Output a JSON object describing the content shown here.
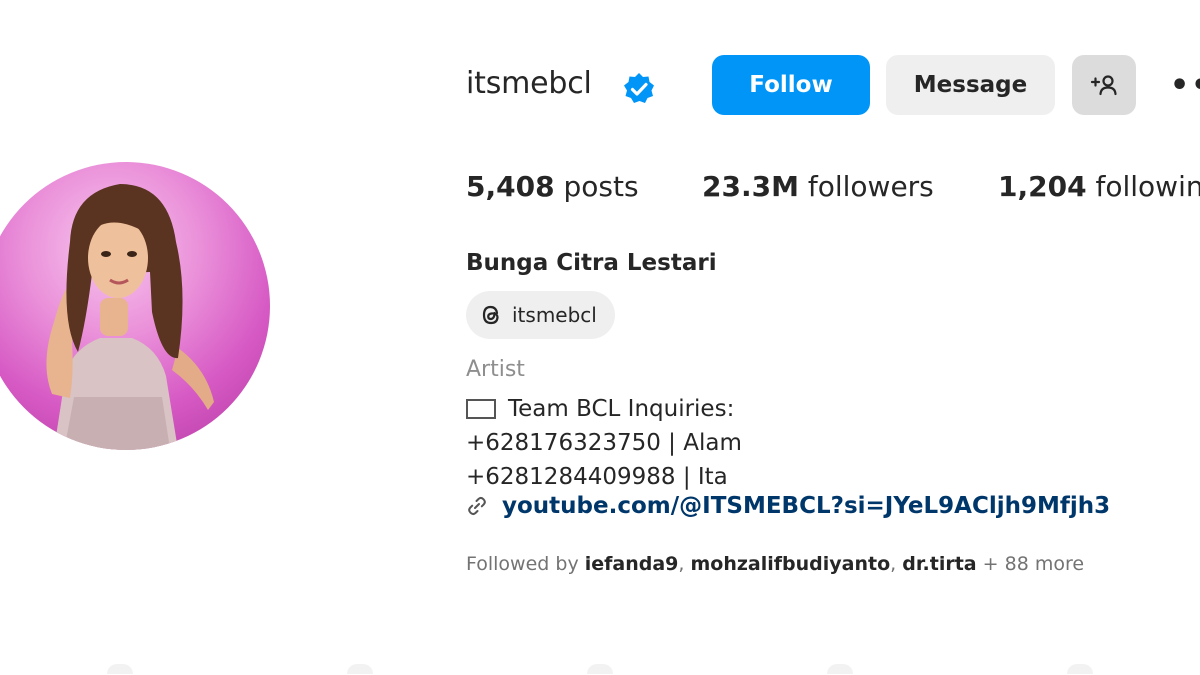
{
  "profile": {
    "username": "itsmebcl",
    "full_name": "Bunga Citra Lestari",
    "threads_handle": "itsmebcl",
    "category": "Artist",
    "bio_lines": [
      "Team BCL Inquiries:",
      "+628176323750 | Alam",
      "+6281284409988 | Ita"
    ],
    "link": "youtube.com/@ITSMEBCL?si=JYeL9ACljh9Mfjh3"
  },
  "stats": {
    "posts_count": "5,408",
    "posts_label": "posts",
    "followers_count": "23.3M",
    "followers_label": "followers",
    "following_count": "1,204",
    "following_label": "following"
  },
  "actions": {
    "follow_label": "Follow",
    "message_label": "Message",
    "suggest_icon": "add-person-icon",
    "more_icon": "more-options-icon"
  },
  "followed_by": {
    "prefix": "Followed by",
    "users": [
      "iefanda9",
      "mohzalifbudiyanto",
      "dr.tirta"
    ],
    "more": "+ 88 more"
  },
  "colors": {
    "accent": "#0095f6",
    "verified": "#0095f6",
    "link": "#00376b",
    "avatar_background": "#e07ad3"
  },
  "icons": {
    "verified": "verified-badge-icon",
    "threads": "threads-icon",
    "mail": "mail-icon",
    "link": "link-icon"
  }
}
